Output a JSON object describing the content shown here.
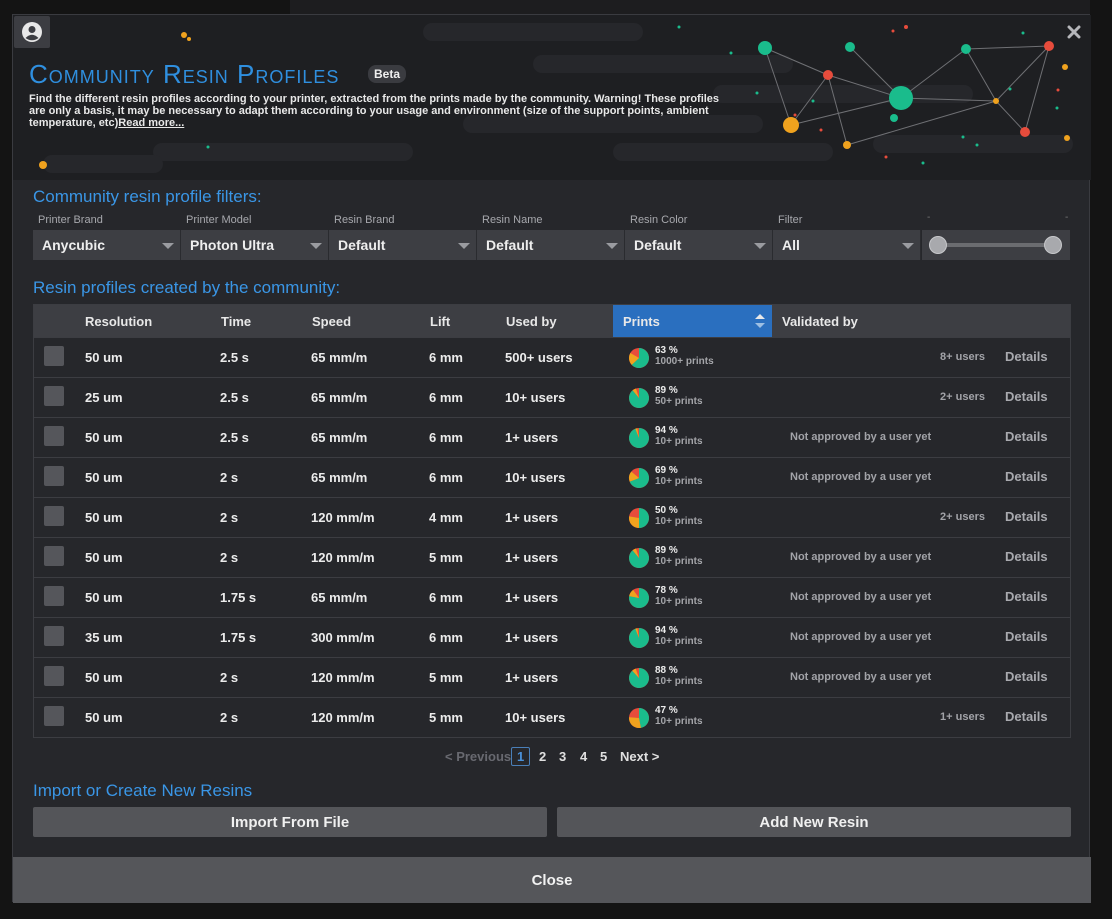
{
  "header": {
    "title": "Community Resin Profiles",
    "badge": "Beta",
    "description": "Find the different resin profiles according to your printer, extracted from the prints made by the community. Warning! These profiles are only a basis, it may be necessary to adapt them according to your usage and environment (size of the support points, ambient temperature, etc)",
    "read_more": "Read more..."
  },
  "filters": {
    "title": "Community resin profile filters:",
    "items": [
      {
        "label": "Printer Brand",
        "value": "Anycubic"
      },
      {
        "label": "Printer Model",
        "value": "Photon Ultra"
      },
      {
        "label": "Resin Brand",
        "value": "Default"
      },
      {
        "label": "Resin Name",
        "value": "Default"
      },
      {
        "label": "Resin Color",
        "value": "Default"
      },
      {
        "label": "Filter",
        "value": "All"
      }
    ],
    "slider_left_dash": "-",
    "slider_right_dash": "-"
  },
  "table": {
    "title": "Resin profiles created by the community:",
    "columns": [
      "Resolution",
      "Time",
      "Speed",
      "Lift",
      "Used by",
      "Prints",
      "Validated by"
    ],
    "details_label": "Details",
    "rows": [
      {
        "resolution": "50 um",
        "time": "2.5 s",
        "speed": "65 mm/m",
        "lift": "6 mm",
        "used_by": "500+ users",
        "pct": "63 %",
        "prints": "1000+ prints",
        "validated": "8+ users"
      },
      {
        "resolution": "25 um",
        "time": "2.5 s",
        "speed": "65 mm/m",
        "lift": "6 mm",
        "used_by": "10+ users",
        "pct": "89 %",
        "prints": "50+ prints",
        "validated": "2+ users"
      },
      {
        "resolution": "50 um",
        "time": "2.5 s",
        "speed": "65 mm/m",
        "lift": "6 mm",
        "used_by": "1+ users",
        "pct": "94 %",
        "prints": "10+ prints",
        "validated": "Not approved by a user yet"
      },
      {
        "resolution": "50 um",
        "time": "2 s",
        "speed": "65 mm/m",
        "lift": "6 mm",
        "used_by": "10+ users",
        "pct": "69 %",
        "prints": "10+ prints",
        "validated": "Not approved by a user yet"
      },
      {
        "resolution": "50 um",
        "time": "2 s",
        "speed": "120 mm/m",
        "lift": "4 mm",
        "used_by": "1+ users",
        "pct": "50 %",
        "prints": "10+ prints",
        "validated": "2+ users"
      },
      {
        "resolution": "50 um",
        "time": "2 s",
        "speed": "120 mm/m",
        "lift": "5 mm",
        "used_by": "1+ users",
        "pct": "89 %",
        "prints": "10+ prints",
        "validated": "Not approved by a user yet"
      },
      {
        "resolution": "50 um",
        "time": "1.75 s",
        "speed": "65 mm/m",
        "lift": "6 mm",
        "used_by": "1+ users",
        "pct": "78 %",
        "prints": "10+ prints",
        "validated": "Not approved by a user yet"
      },
      {
        "resolution": "35 um",
        "time": "1.75 s",
        "speed": "300 mm/m",
        "lift": "6 mm",
        "used_by": "1+ users",
        "pct": "94 %",
        "prints": "10+ prints",
        "validated": "Not approved by a user yet"
      },
      {
        "resolution": "50 um",
        "time": "2 s",
        "speed": "120 mm/m",
        "lift": "5 mm",
        "used_by": "1+ users",
        "pct": "88 %",
        "prints": "10+ prints",
        "validated": "Not approved by a user yet"
      },
      {
        "resolution": "50 um",
        "time": "2 s",
        "speed": "120 mm/m",
        "lift": "5 mm",
        "used_by": "10+ users",
        "pct": "47 %",
        "prints": "10+ prints",
        "validated": "1+ users"
      }
    ]
  },
  "pagination": {
    "previous": "< Previous",
    "pages": [
      "1",
      "2",
      "3",
      "4",
      "5"
    ],
    "current": "1",
    "next": "Next >"
  },
  "import": {
    "title": "Import or Create New Resins",
    "import_button": "Import From File",
    "add_button": "Add New Resin"
  },
  "close_label": "Close",
  "colors": {
    "accent": "#2f8fdf",
    "success": "#1abc8c",
    "warning": "#f0a21e",
    "error": "#e74c3c"
  },
  "icons": {
    "user": "user-circle-icon",
    "close": "close-icon",
    "caret": "chevron-down-icon",
    "sort": "sort-icon",
    "pie": "pie-chart-icon"
  }
}
